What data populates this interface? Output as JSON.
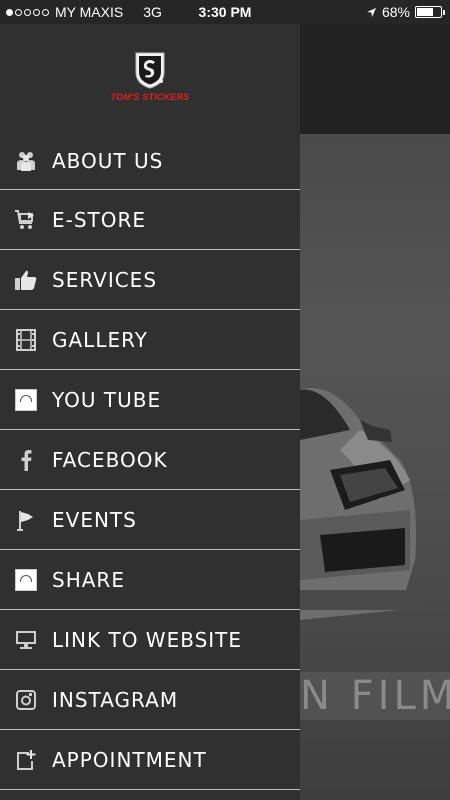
{
  "status_bar": {
    "carrier": "MY MAXIS",
    "network": "3G",
    "time": "3:30 PM",
    "battery_percent": "68%",
    "battery_level": 0.68,
    "signal_bars_filled": 1,
    "signal_bars_total": 5
  },
  "drawer": {
    "logo_text": "TOM'S STICKERS",
    "items": [
      {
        "label": "ABOUT US",
        "icon": "people-icon"
      },
      {
        "label": "E-STORE",
        "icon": "cart-icon"
      },
      {
        "label": "SERVICES",
        "icon": "thumbs-up-icon"
      },
      {
        "label": "GALLERY",
        "icon": "film-icon"
      },
      {
        "label": "YOU TUBE",
        "icon": "youtube-icon"
      },
      {
        "label": "FACEBOOK",
        "icon": "facebook-icon"
      },
      {
        "label": "EVENTS",
        "icon": "flag-icon"
      },
      {
        "label": "SHARE",
        "icon": "share-icon"
      },
      {
        "label": "LINK TO WEBSITE",
        "icon": "monitor-icon"
      },
      {
        "label": "INSTAGRAM",
        "icon": "instagram-icon"
      },
      {
        "label": "APPOINTMENT",
        "icon": "calendar-plus-icon"
      }
    ]
  },
  "background": {
    "hero_text": "N FILM"
  },
  "colors": {
    "drawer_bg": "#303030",
    "divider": "#bdbdbd",
    "logo_red": "#e02020",
    "status_bar_bg": "#262626"
  }
}
